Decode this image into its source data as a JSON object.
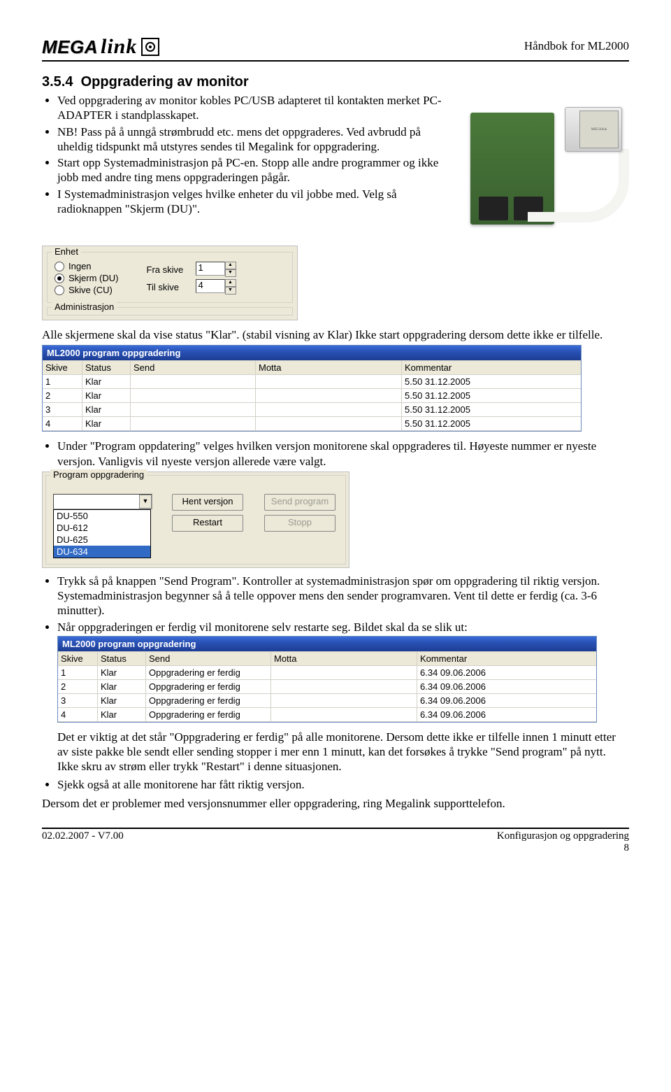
{
  "header": {
    "logo_left": "MEGA",
    "logo_right": "link",
    "doc_title": "Håndbok for ML2000"
  },
  "section": {
    "number": "3.5.4",
    "title": "Oppgradering av monitor"
  },
  "intro_bullets": [
    "Ved oppgradering av monitor kobles PC/USB adapteret til kontakten merket PC-ADAPTER i standplasskapet.",
    "NB! Pass på å unngå strømbrudd etc. mens det oppgraderes. Ved avbrudd på uheldig tidspunkt må utstyres sendes til Megalink for oppgradering.",
    "Start opp Systemadministrasjon på PC-en. Stopp alle andre programmer og ikke jobb med andre ting mens oppgraderingen pågår.",
    "I Systemadministrasjon velges hvilke enheter du vil jobbe med. Velg så radioknappen \"Skjerm (DU)\"."
  ],
  "enhet": {
    "group_title": "Enhet",
    "radios": [
      "Ingen",
      "Skjerm (DU)",
      "Skive (CU)"
    ],
    "selected": "Skjerm (DU)",
    "fra_label": "Fra skive",
    "fra_value": "1",
    "til_label": "Til skive",
    "til_value": "4",
    "admin_title": "Administrasjon"
  },
  "para1": "Alle skjermene skal da vise status \"Klar\". (stabil visning av Klar) Ikke start oppgradering dersom dette ikke er tilfelle.",
  "grid1": {
    "title": "ML2000 program oppgradering",
    "cols": [
      "Skive",
      "Status",
      "Send",
      "Motta",
      "Kommentar"
    ],
    "rows": [
      [
        "1",
        "Klar",
        "",
        "",
        "5.50 31.12.2005"
      ],
      [
        "2",
        "Klar",
        "",
        "",
        "5.50 31.12.2005"
      ],
      [
        "3",
        "Klar",
        "",
        "",
        "5.50 31.12.2005"
      ],
      [
        "4",
        "Klar",
        "",
        "",
        "5.50 31.12.2005"
      ]
    ]
  },
  "bullet_prog": "Under \"Program oppdatering\" velges hvilken versjon monitorene skal oppgraderes til. Høyeste nummer er nyeste versjon. Vanligvis vil nyeste versjon allerede være valgt.",
  "prog": {
    "group_title": "Program oppgradering",
    "options": [
      "DU-550",
      "DU-612",
      "DU-625",
      "DU-634"
    ],
    "selected": "DU-634",
    "btn_hent": "Hent versjon",
    "btn_restart": "Restart",
    "btn_send": "Send program",
    "btn_stopp": "Stopp"
  },
  "bullets2": [
    "Trykk så på knappen \"Send Program\". Kontroller at systemadministrasjon spør om oppgradering til riktig versjon. Systemadministrasjon begynner så å telle oppover mens den sender programvaren. Vent til dette er ferdig (ca. 3-6 minutter).",
    "Når oppgraderingen er ferdig vil monitorene selv restarte seg. Bildet skal da se slik ut:"
  ],
  "grid2": {
    "title": "ML2000 program oppgradering",
    "cols": [
      "Skive",
      "Status",
      "Send",
      "Motta",
      "Kommentar"
    ],
    "rows": [
      [
        "1",
        "Klar",
        "Oppgradering er ferdig",
        "",
        "6.34 09.06.2006"
      ],
      [
        "2",
        "Klar",
        "Oppgradering er ferdig",
        "",
        "6.34 09.06.2006"
      ],
      [
        "3",
        "Klar",
        "Oppgradering er ferdig",
        "",
        "6.34 09.06.2006"
      ],
      [
        "4",
        "Klar",
        "Oppgradering er ferdig",
        "",
        "6.34 09.06.2006"
      ]
    ]
  },
  "post_para": "Det er viktig at det står \"Oppgradering er ferdig\" på alle monitorene. Dersom dette ikke er tilfelle innen 1 minutt etter av siste pakke ble sendt eller sending stopper i mer enn 1 minutt, kan det forsøkes å trykke \"Send program\" på nytt. Ikke skru av strøm eller trykk \"Restart\" i denne situasjonen.",
  "bullet_last": "Sjekk også at alle monitorene har fått riktig versjon.",
  "closing": "Dersom det er problemer med versjonsnummer eller oppgradering, ring Megalink supporttelefon.",
  "footer": {
    "left": "02.02.2007 - V7.00",
    "right_top": "Konfigurasjon og oppgradering",
    "right_bottom": "8"
  }
}
